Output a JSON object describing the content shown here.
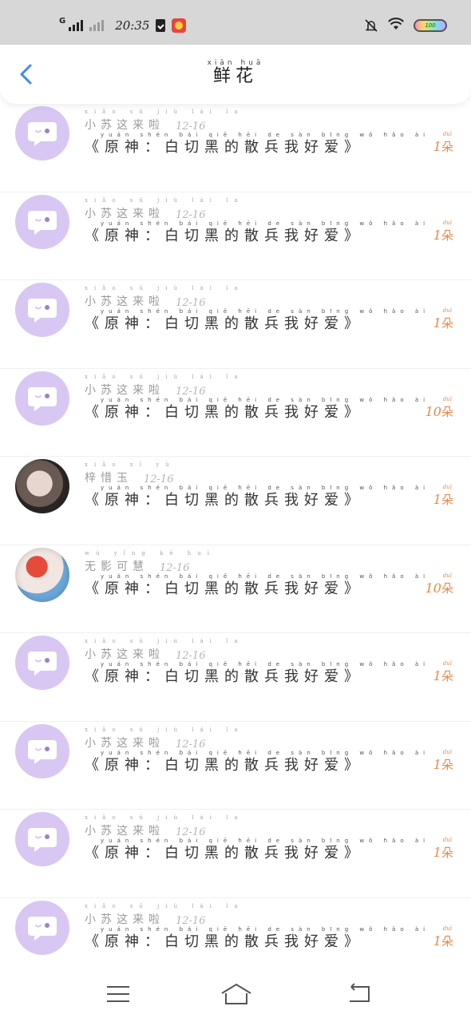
{
  "status_bar": {
    "network_letter": "G",
    "time": "20:35",
    "battery_text": "100"
  },
  "header": {
    "title_pinyin": "xiān huā",
    "title": "鲜花"
  },
  "gift_pinyin": "yuán shén   bái qiē hēi de sàn bīng wǒ hǎo ài",
  "gift_text": "《原神：白切黑的散兵我好爱》",
  "unit_pinyin": "duì",
  "unit": "朵",
  "rows": [
    {
      "avatar": "chat-bubble",
      "sender_pinyin": "xiǎo sū jiù lái la",
      "sender": "小苏这来啦",
      "date": "12-16",
      "count": "1"
    },
    {
      "avatar": "chat-bubble",
      "sender_pinyin": "xiǎo sū jiù lái la",
      "sender": "小苏这来啦",
      "date": "12-16",
      "count": "1"
    },
    {
      "avatar": "chat-bubble",
      "sender_pinyin": "xiǎo sū jiù lái la",
      "sender": "小苏这来啦",
      "date": "12-16",
      "count": "1"
    },
    {
      "avatar": "chat-bubble",
      "sender_pinyin": "xiǎo sū jiù lái la",
      "sender": "小苏这来啦",
      "date": "12-16",
      "count": "10"
    },
    {
      "avatar": "photo",
      "sender_pinyin": "xiǎo xī yù",
      "sender": "梓惜玉",
      "date": "12-16",
      "count": "1"
    },
    {
      "avatar": "photo",
      "sender_pinyin": "wú yǐng kě huì",
      "sender": "无影可慧",
      "date": "12-16",
      "count": "10"
    },
    {
      "avatar": "chat-bubble",
      "sender_pinyin": "xiǎo sū jiù lái la",
      "sender": "小苏这来啦",
      "date": "12-16",
      "count": "1"
    },
    {
      "avatar": "chat-bubble",
      "sender_pinyin": "xiǎo sū jiù lái la",
      "sender": "小苏这来啦",
      "date": "12-16",
      "count": "1"
    },
    {
      "avatar": "chat-bubble",
      "sender_pinyin": "xiǎo sū jiù lái la",
      "sender": "小苏这来啦",
      "date": "12-16",
      "count": "1"
    },
    {
      "avatar": "chat-bubble",
      "sender_pinyin": "xiǎo sū jiù lái la",
      "sender": "小苏这来啦",
      "date": "12-16",
      "count": "1"
    }
  ],
  "colors": {
    "accent_blue": "#3a8ee6",
    "avatar_lavender": "#d8c7f3",
    "count_orange": "#e9894a"
  }
}
